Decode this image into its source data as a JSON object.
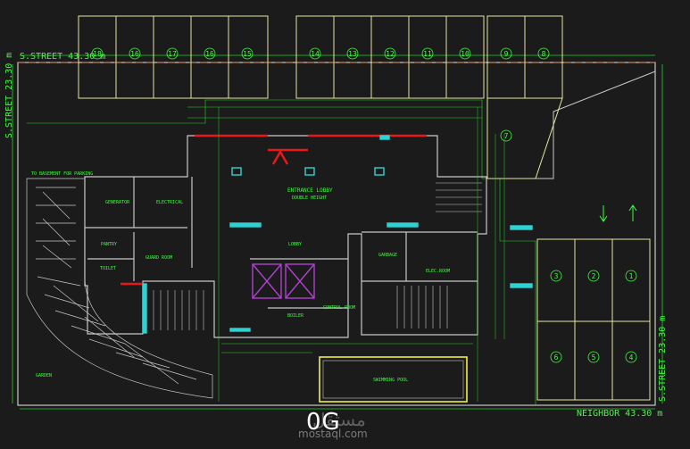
{
  "drawing": {
    "sheet_title": "0G",
    "watermark_text": "مستقل",
    "watermark_url": "mostaql.com",
    "colors": {
      "background": "#1b1b1b",
      "walls": "#c8c8c8",
      "dimensions": "#22d622",
      "text": "#3cff3c",
      "parking": "#e6e6a0",
      "red_walls": "#e81818",
      "cyan": "#2fd2d2",
      "purple": "#b040d0",
      "yellow": "#f0f040",
      "orange_dash": "#d07840"
    }
  },
  "streets": {
    "top": "S.STREET 43.30 m",
    "left": "S.STREET 23.30 m",
    "right": "S.STREET 23.30 m",
    "bottom": "NEIGHBOR 43.30 m"
  },
  "rooms": {
    "entrance_lobby": "ENTRANCE LOBBY",
    "double_height": "DOUBLE HEIGHT",
    "lobby": "LOBBY",
    "generator": "GENERATOR",
    "electrical": "ELECTRICAL",
    "pantry": "PANTRY",
    "guard_room": "GUARD ROOM",
    "toilet": "TOILET",
    "boiler": "BOILER",
    "control_room": "CONTROL ROOM",
    "garbage": "GARBAGE",
    "elec_room": "ELEC.ROOM",
    "swimming_pool": "SWIMMING POOL",
    "garden": "GARDEN",
    "to_basement": "TO BASEMENT FOR PARKING"
  },
  "parking": {
    "top_left": [
      "18",
      "16",
      "17",
      "16",
      "15"
    ],
    "top_right": [
      "14",
      "13",
      "12",
      "11",
      "10"
    ],
    "top_far_right": [
      "9",
      "8"
    ],
    "diagonal": "7",
    "right_upper": [
      "3",
      "2",
      "1"
    ],
    "right_lower": [
      "6",
      "5",
      "4"
    ]
  }
}
